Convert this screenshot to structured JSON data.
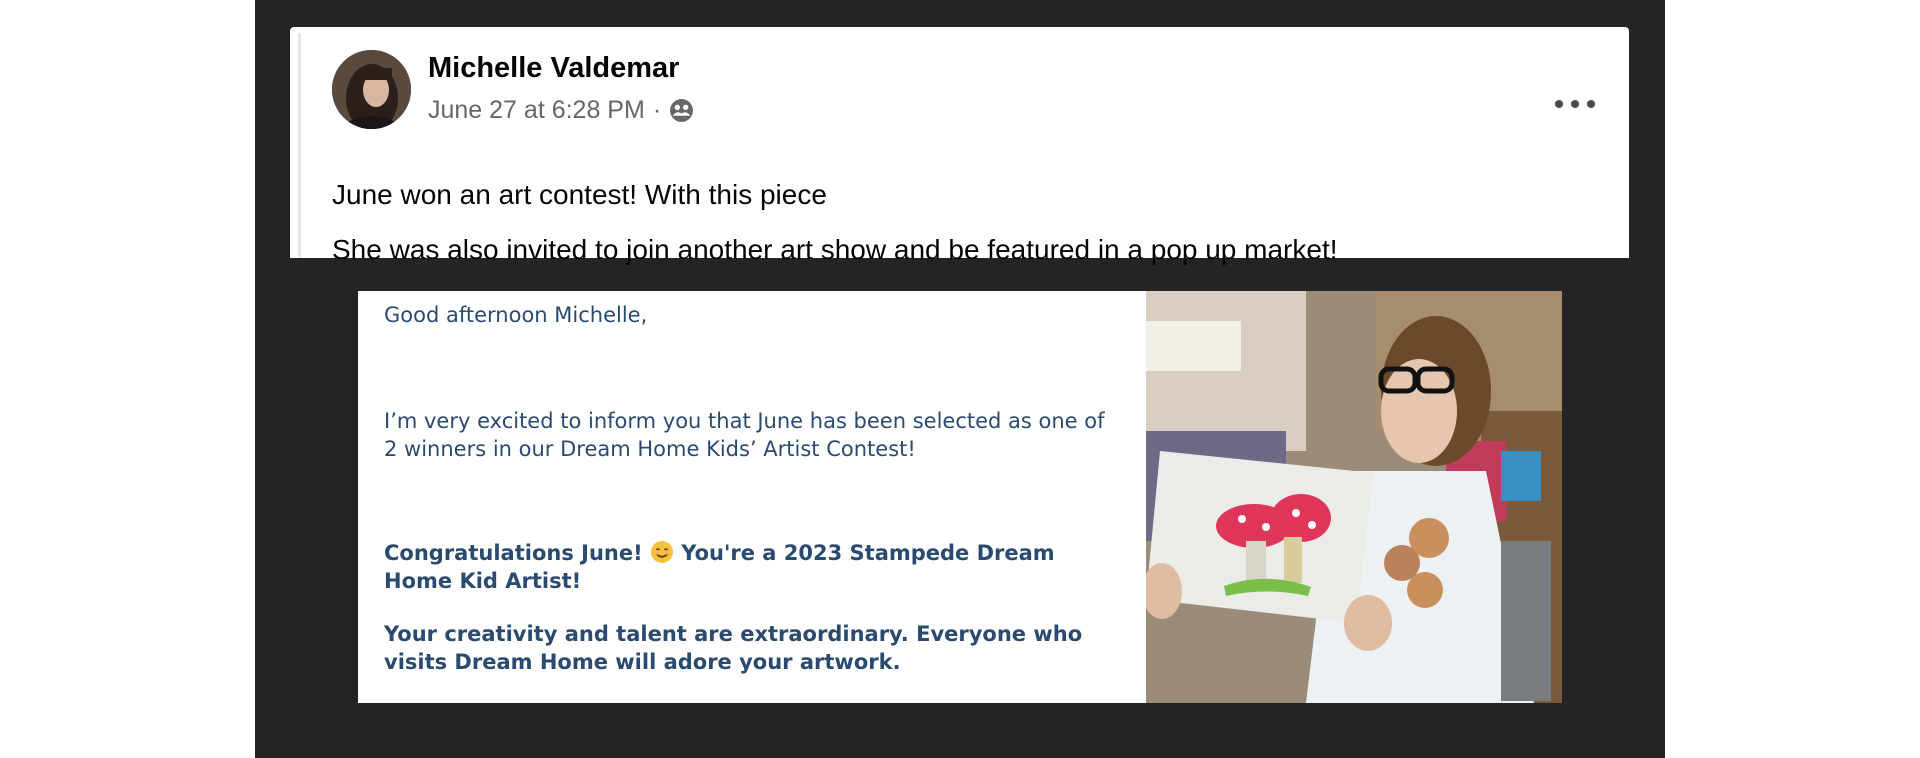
{
  "post": {
    "author": "Michelle Valdemar",
    "timestamp": "June 27 at 6:28 PM",
    "separator": "·",
    "audience_icon": "friends-icon",
    "more_icon": "more-options-icon",
    "lines": [
      "June won an art contest! With this piece",
      "She was also invited to join another art show and be featured in a pop up market!"
    ]
  },
  "email": {
    "greeting": "Good afternoon Michelle,",
    "body": "I’m very excited to inform you that June has been selected as one of 2 winners in our Dream Home Kids’ Artist Contest!",
    "congrats_before": "Congratulations June!",
    "congrats_after": "You're a 2023 Stampede Dream Home Kid Artist!",
    "creativity": "Your creativity and talent are extraordinary. Everyone who visits Dream Home will adore your artwork."
  },
  "colors": {
    "dark_background": "#242424",
    "email_text": "#2b4a6f",
    "meta_text": "#65676b"
  }
}
